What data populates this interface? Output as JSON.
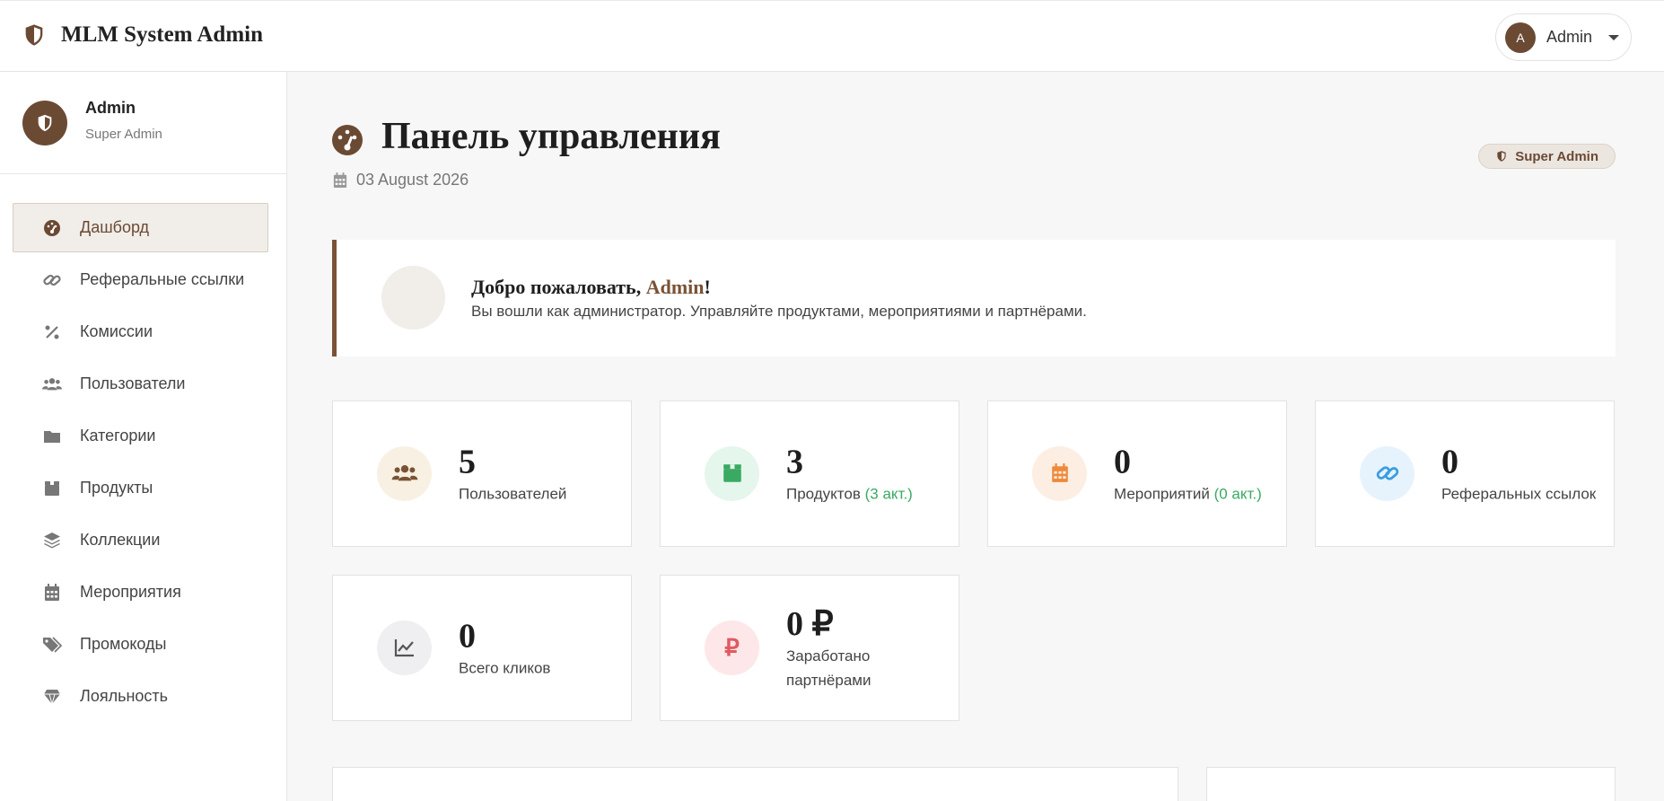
{
  "header": {
    "brand": "MLM System Admin",
    "user_initial": "A",
    "user_name": "Admin",
    "icons": {
      "brand": "shield-icon",
      "dropdown": "caret-down-icon"
    }
  },
  "sidebar": {
    "profile_name": "Admin",
    "profile_role": "Super Admin",
    "items": [
      {
        "label": "Дашборд",
        "icon": "dashboard-icon",
        "active": true
      },
      {
        "label": "Реферальные ссылки",
        "icon": "link-icon"
      },
      {
        "label": "Комиссии",
        "icon": "percent-icon"
      },
      {
        "label": "Пользователи",
        "icon": "users-icon"
      },
      {
        "label": "Категории",
        "icon": "folder-icon"
      },
      {
        "label": "Продукты",
        "icon": "box-icon"
      },
      {
        "label": "Коллекции",
        "icon": "layers-icon"
      },
      {
        "label": "Мероприятия",
        "icon": "calendar-icon"
      },
      {
        "label": "Промокоды",
        "icon": "tags-icon"
      },
      {
        "label": "Лояльность",
        "icon": "gem-icon"
      }
    ]
  },
  "main": {
    "title": "Панель управления",
    "date": "03 August 2026",
    "role_badge": "Super Admin",
    "welcome": {
      "greeting": "Добро пожаловать, ",
      "name": "Admin",
      "exclaim": "!",
      "text": "Вы вошли как администратор. Управляйте продуктами, мероприятиями и партнёрами."
    },
    "stats": [
      {
        "value": "5",
        "label": "Пользователей",
        "sub": "",
        "icon": "users-icon"
      },
      {
        "value": "3",
        "label": "Продуктов",
        "sub": "(3 акт.)",
        "icon": "box-icon"
      },
      {
        "value": "0",
        "label": "Мероприятий",
        "sub": "(0 акт.)",
        "icon": "calendar-icon"
      },
      {
        "value": "0",
        "label": "Реферальных ссылок",
        "sub": "",
        "icon": "link-icon"
      },
      {
        "value": "0",
        "label": "Всего кликов",
        "sub": "",
        "icon": "chart-line-icon"
      },
      {
        "value": "0 ₽",
        "label": "Заработано партнёрами",
        "sub": "",
        "icon": "ruble-icon"
      }
    ]
  },
  "colors": {
    "accent": "#6b4a34",
    "active_bg": "#f1ede9",
    "success": "#3aaa62"
  }
}
